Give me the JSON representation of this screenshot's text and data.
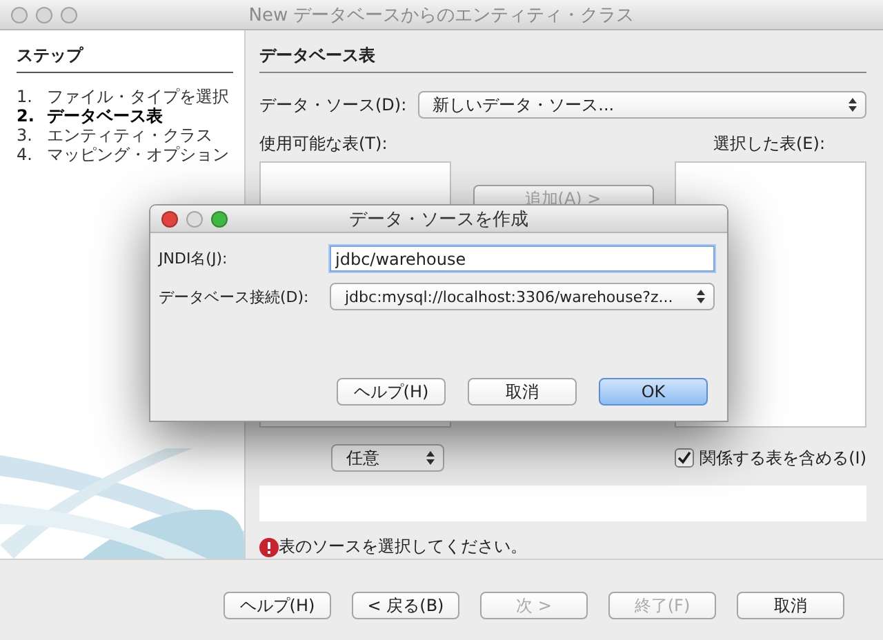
{
  "window": {
    "title": "New データベースからのエンティティ・クラス"
  },
  "steps": {
    "heading": "ステップ",
    "items": [
      {
        "number": "1.",
        "label": "ファイル・タイプを選択",
        "selected": false
      },
      {
        "number": "2.",
        "label": "データベース表",
        "selected": true
      },
      {
        "number": "3.",
        "label": "エンティティ・クラス",
        "selected": false
      },
      {
        "number": "4.",
        "label": "マッピング・オプション",
        "selected": false
      }
    ]
  },
  "panel": {
    "heading": "データベース表",
    "data_source": {
      "label": "データ・ソース(D):",
      "value": "新しいデータ・ソース..."
    },
    "available_label": "使用可能な表(T):",
    "selected_label": "選択した表(E):",
    "add_button": {
      "label": "追加(A) >",
      "disabled": true
    },
    "mode_select": {
      "value": "任意"
    },
    "include_related": {
      "label": "関係する表を含める(I)",
      "checked": true
    },
    "error": "表のソースを選択してください。"
  },
  "buttons": [
    {
      "label": "ヘルプ(H)",
      "disabled": false
    },
    {
      "label": "< 戻る(B)",
      "disabled": false
    },
    {
      "label": "次 >",
      "disabled": true
    },
    {
      "label": "終了(F)",
      "disabled": true
    },
    {
      "label": "取消",
      "disabled": false
    }
  ],
  "dialog": {
    "title": "データ・ソースを作成",
    "jndi": {
      "label": "JNDI名(J):",
      "value": "jdbc/warehouse"
    },
    "connection": {
      "label": "データベース接続(D):",
      "value": "jdbc:mysql://localhost:3306/warehouse?z..."
    },
    "buttons": [
      {
        "label": "ヘルプ(H)",
        "default": false
      },
      {
        "label": "取消",
        "default": false
      },
      {
        "label": "OK",
        "default": true
      }
    ]
  }
}
